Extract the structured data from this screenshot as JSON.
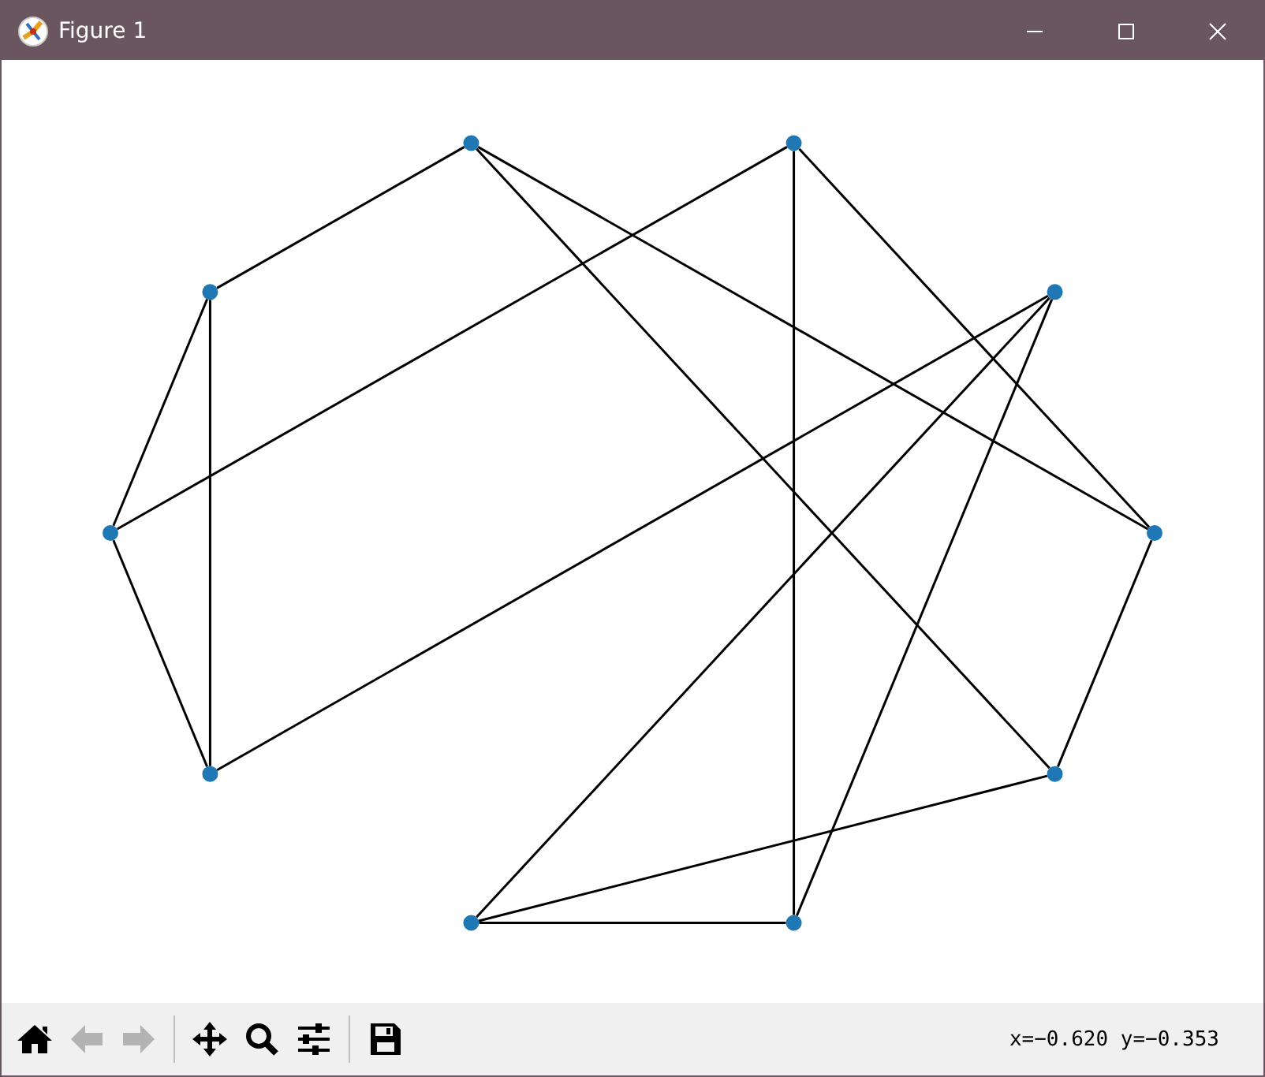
{
  "window": {
    "title": "Figure 1"
  },
  "toolbar": [
    {
      "kind": "home",
      "disabled": false
    },
    {
      "kind": "back",
      "disabled": true
    },
    {
      "kind": "forward",
      "disabled": true
    },
    {
      "kind": "separator"
    },
    {
      "kind": "pan",
      "disabled": false
    },
    {
      "kind": "zoom",
      "disabled": false
    },
    {
      "kind": "configure",
      "disabled": false
    },
    {
      "kind": "separator"
    },
    {
      "kind": "save",
      "disabled": false
    }
  ],
  "status": "x=−0.620 y=−0.353"
}
